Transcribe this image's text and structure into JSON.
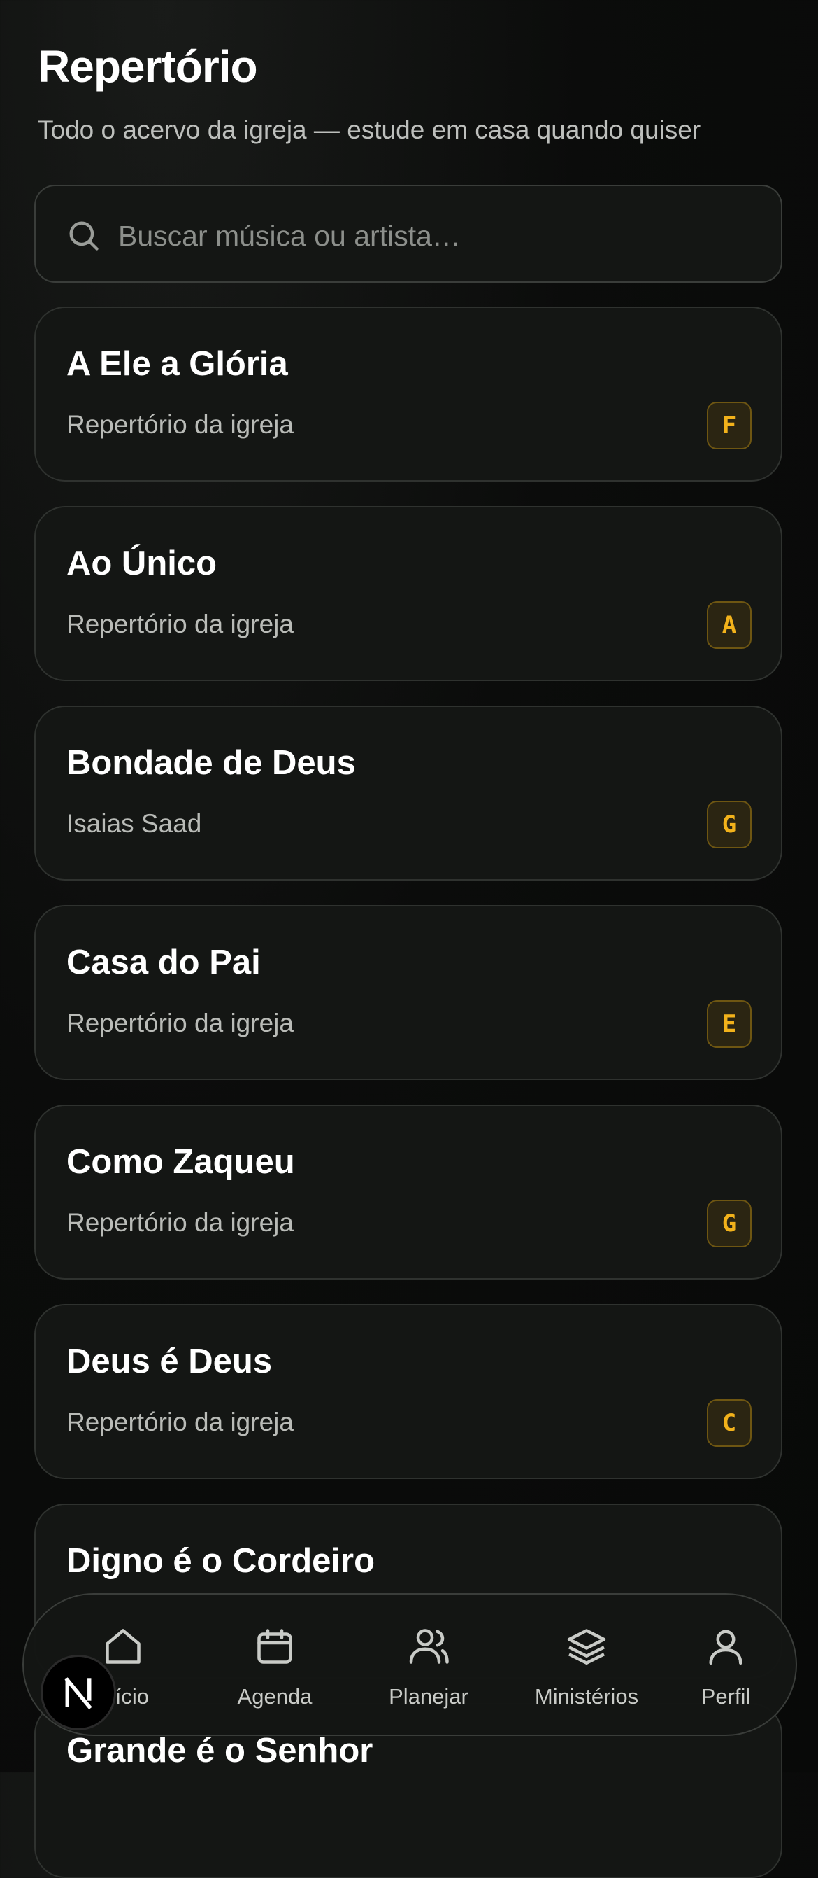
{
  "header": {
    "title": "Repertório",
    "subtitle": "Todo o acervo da igreja — estude em casa quando quiser"
  },
  "search": {
    "placeholder": "Buscar música ou artista…",
    "value": ""
  },
  "songs": [
    {
      "title": "A Ele a Glória",
      "artist": "Repertório da igreja",
      "key": "F"
    },
    {
      "title": "Ao Único",
      "artist": "Repertório da igreja",
      "key": "A"
    },
    {
      "title": "Bondade de Deus",
      "artist": "Isaias Saad",
      "key": "G"
    },
    {
      "title": "Casa do Pai",
      "artist": "Repertório da igreja",
      "key": "E"
    },
    {
      "title": "Como Zaqueu",
      "artist": "Repertório da igreja",
      "key": "G"
    },
    {
      "title": "Deus é Deus",
      "artist": "Repertório da igreja",
      "key": "C"
    },
    {
      "title": "Digno é o Cordeiro",
      "artist": "",
      "key": ""
    },
    {
      "title": "Grande é o Senhor",
      "artist": "",
      "key": ""
    }
  ],
  "tabbar": {
    "items": [
      {
        "label": "Início",
        "icon": "home-icon"
      },
      {
        "label": "Agenda",
        "icon": "calendar-icon"
      },
      {
        "label": "Planejar",
        "icon": "users-icon"
      },
      {
        "label": "Ministérios",
        "icon": "layers-icon"
      },
      {
        "label": "Perfil",
        "icon": "user-icon"
      }
    ]
  },
  "fab": {
    "label": "N"
  },
  "colors": {
    "background": "#0b0c0b",
    "card": "#141614",
    "accent": "#f2b21b"
  }
}
